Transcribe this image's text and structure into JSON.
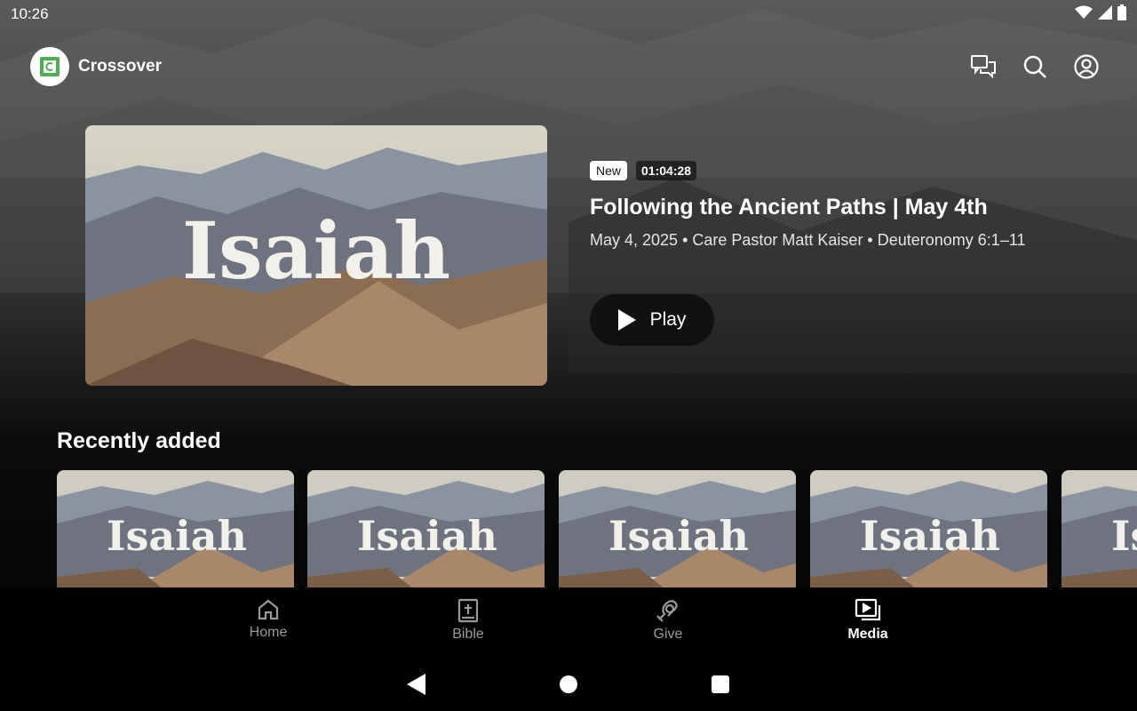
{
  "status_bar": {
    "time": "10:26",
    "icons": [
      "wifi-icon",
      "signal-icon",
      "battery-icon"
    ]
  },
  "app_bar": {
    "brand_name": "Crossover",
    "actions": [
      "chat-icon",
      "search-icon",
      "account-icon"
    ]
  },
  "hero": {
    "thumbnail_text": "Isaiah",
    "badge_new": "New",
    "duration": "01:04:28",
    "title": "Following the Ancient Paths | May 4th",
    "meta": "May 4, 2025 • Care Pastor Matt Kaiser • Deuteronomy 6:1–11",
    "play_label": "Play"
  },
  "recently_added": {
    "title": "Recently added",
    "cards": [
      {
        "text": "Isaiah"
      },
      {
        "text": "Isaiah"
      },
      {
        "text": "Isaiah"
      },
      {
        "text": "Isaiah"
      },
      {
        "text": "Isaiah"
      }
    ]
  },
  "bottom_nav": {
    "items": [
      {
        "label": "Home",
        "icon": "home-icon",
        "active": false
      },
      {
        "label": "Bible",
        "icon": "bible-icon",
        "active": false
      },
      {
        "label": "Give",
        "icon": "give-icon",
        "active": false
      },
      {
        "label": "Media",
        "icon": "media-icon",
        "active": true
      }
    ]
  },
  "system_nav": [
    "back-icon",
    "home-circle-icon",
    "recents-icon"
  ],
  "colors": {
    "brand_green": "#4caf50",
    "background": "#000000"
  }
}
